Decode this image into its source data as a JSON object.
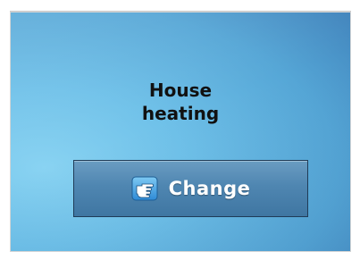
{
  "panel": {
    "title_line1": "House",
    "title_line2": "heating",
    "button_label": "Change",
    "button_icon": "pointing-hand-icon"
  }
}
